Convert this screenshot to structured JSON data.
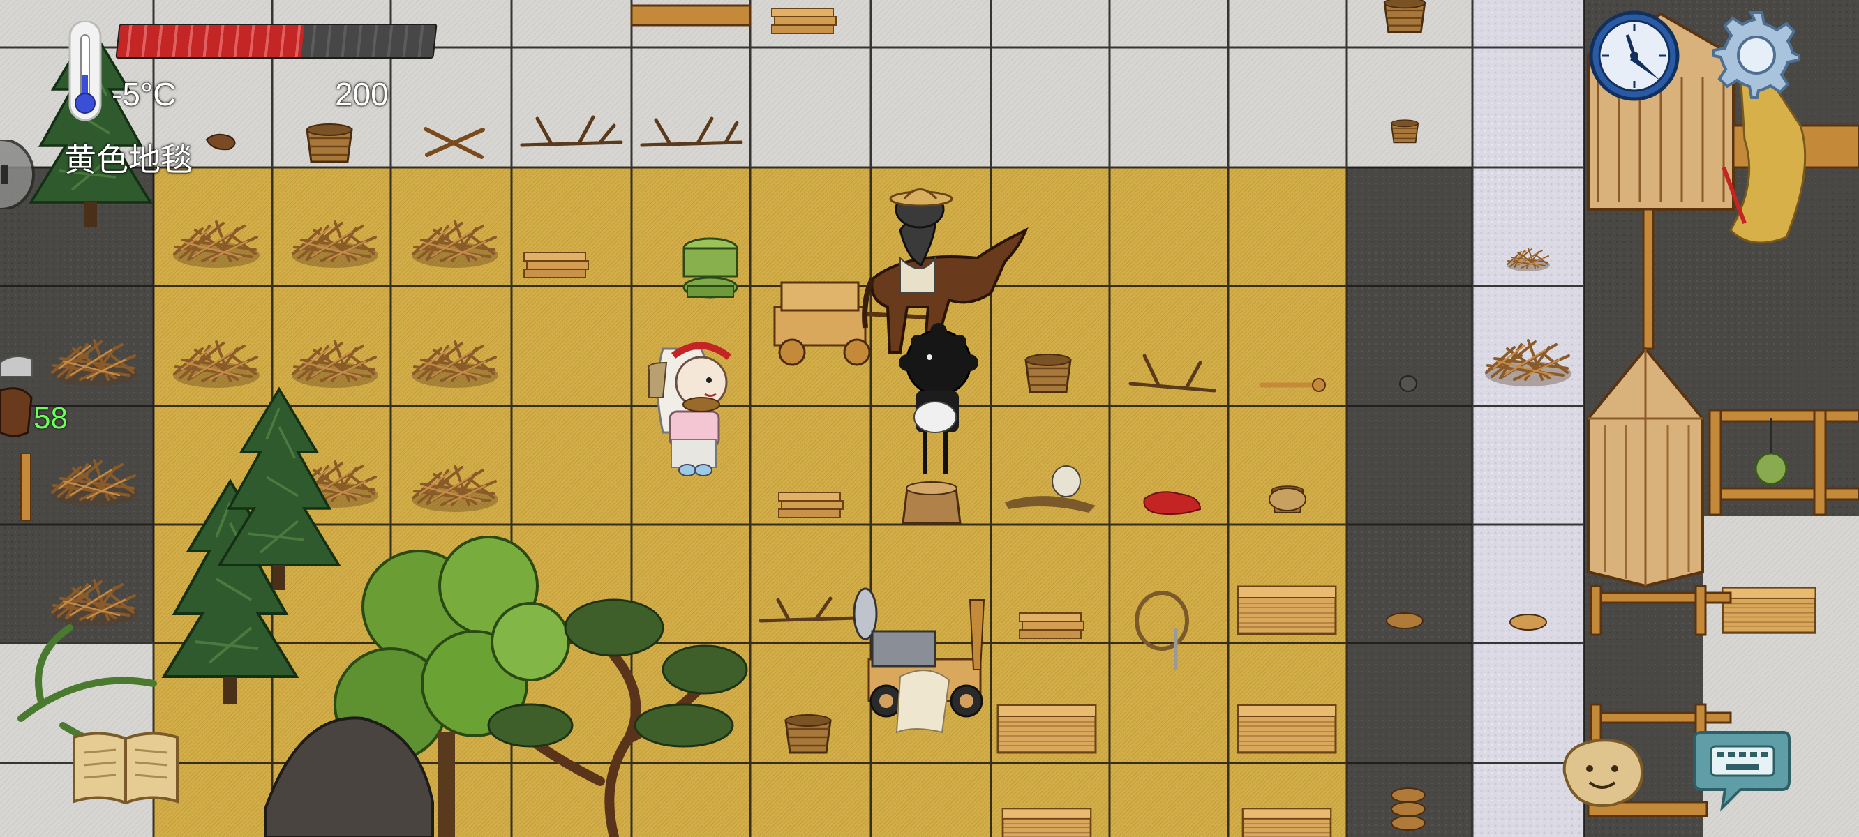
{
  "hud": {
    "temperature": "-5°C",
    "yum_value": "200",
    "hovered_object": "黄色地毯",
    "other_player_age": "58",
    "food_meter": {
      "filled_pips": 14,
      "total_pips": 24
    }
  },
  "icons": {
    "thermometer": "thermometer-icon",
    "clock": "compass-clock-icon",
    "settings": "gear-icon",
    "tech_book": "open-book-icon",
    "emote": "potato-face-icon",
    "chat": "keyboard-speech-bubble-icon",
    "sound": "speaker-icon"
  },
  "colors": {
    "rug": "#d6b04a",
    "snow": "#d8d7d4",
    "stone": "#dcdce6",
    "ground": "#4a4846",
    "food_bar": "#c42626",
    "age_text": "#6cff5a"
  }
}
